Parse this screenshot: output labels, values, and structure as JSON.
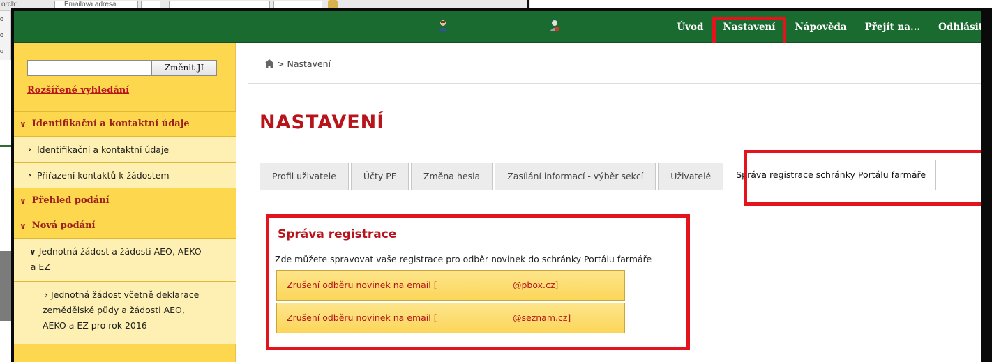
{
  "background": {
    "top_fragment_left": "orch:",
    "top_fragment_email": "Emailová adresa",
    "left_strip": [
      "o",
      "o",
      "o"
    ]
  },
  "header": {
    "nav": [
      "Úvod",
      "Nastavení",
      "Nápověda",
      "Přejít na...",
      "Odhlásit"
    ],
    "highlighted": "Nastavení",
    "color": "#1a6b30"
  },
  "sidebar": {
    "search_placeholder": "",
    "search_button": "Změnit JI",
    "advanced_search": "Rozšířené vyhledání",
    "items": [
      {
        "level": 1,
        "label": "Identifikační a kontaktní údaje"
      },
      {
        "level": 2,
        "label": "Identifikační a kontaktní údaje"
      },
      {
        "level": 2,
        "label": "Přiřazení kontaktů k žádostem"
      },
      {
        "level": 1,
        "label": "Přehled podání"
      },
      {
        "level": 1,
        "label": "Nová podání"
      },
      {
        "level": 3,
        "label_lines": [
          "Jednotná žádost a žádosti AEO, AEKO",
          "a EZ"
        ]
      },
      {
        "level": 4,
        "label_lines": [
          "Jednotná žádost včetně deklarace",
          "zemědělské půdy a žádosti AEO,",
          "AEKO a EZ pro rok 2016"
        ]
      }
    ],
    "bg_color": "#fdd84f"
  },
  "content": {
    "breadcrumb_sep": ">",
    "breadcrumb": "Nastavení",
    "title": "NASTAVENÍ",
    "tabs": [
      "Profil uživatele",
      "Účty PF",
      "Změna hesla",
      "Zasílání informací - výběr sekcí",
      "Uživatelé",
      "Správa registrace schránky Portálu farmáře"
    ],
    "active_tab": "Správa registrace schránky Portálu farmáře",
    "section": {
      "title": "Správa registrace",
      "description": "Zde můžete spravovat vaše registrace pro odběr novinek do schránky Portálu farmáře",
      "buttons": [
        {
          "prefix": "Zrušení odběru novinek na email [",
          "suffix": "@pbox.cz]"
        },
        {
          "prefix": "Zrušení odběru novinek na email [",
          "suffix": "@seznam.cz]"
        }
      ]
    },
    "accent_red": "#b8141b",
    "highlight_red": "#e3141e"
  }
}
